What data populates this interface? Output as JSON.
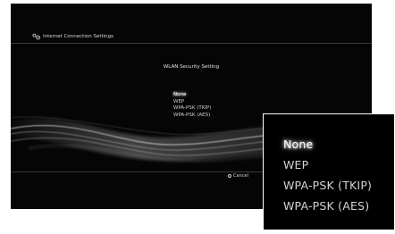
{
  "header": {
    "title": "Internet Connection Settings",
    "icon": "network-settings-icon"
  },
  "main": {
    "section_title": "WLAN Security Setting",
    "options": [
      {
        "label": "None",
        "selected": true
      },
      {
        "label": "WEP",
        "selected": false
      },
      {
        "label": "WPA-PSK (TKIP)",
        "selected": false
      },
      {
        "label": "WPA-PSK (AES)",
        "selected": false
      }
    ]
  },
  "footer": {
    "cancel_label": "Cancel",
    "cancel_icon": "circle-button-icon"
  },
  "zoom": {
    "options": [
      {
        "label": "None",
        "selected": true
      },
      {
        "label": "WEP",
        "selected": false
      },
      {
        "label": "WPA-PSK (TKIP)",
        "selected": false
      },
      {
        "label": "WPA-PSK (AES)",
        "selected": false
      }
    ]
  },
  "colors": {
    "background": "#050505",
    "text": "#d0d0d0",
    "highlight": "#ffffff",
    "frame": "#ffffff"
  }
}
